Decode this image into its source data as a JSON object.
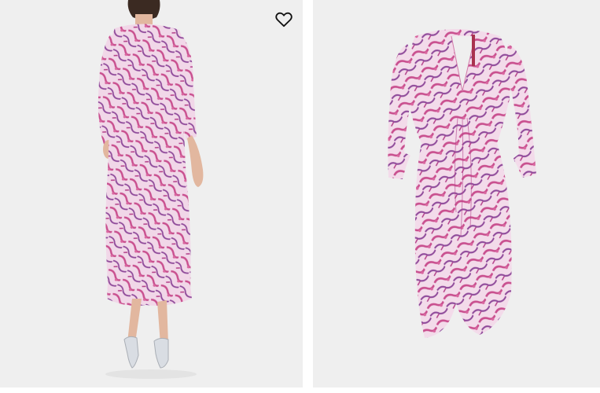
{
  "gallery": {
    "images": [
      {
        "subject": "model-back-view",
        "alt": ""
      },
      {
        "subject": "dress-flat-lay",
        "alt": ""
      }
    ],
    "favorite": {
      "icon": "heart-outline-icon",
      "state": "not-favorited"
    }
  },
  "colors": {
    "background": "#efefef",
    "dress_base": "#f1d7e8",
    "dress_print_pink": "#c9508f",
    "dress_print_purple": "#8f4a9a",
    "zip_trim": "#a8324f",
    "sandals": "#d9dde3"
  }
}
